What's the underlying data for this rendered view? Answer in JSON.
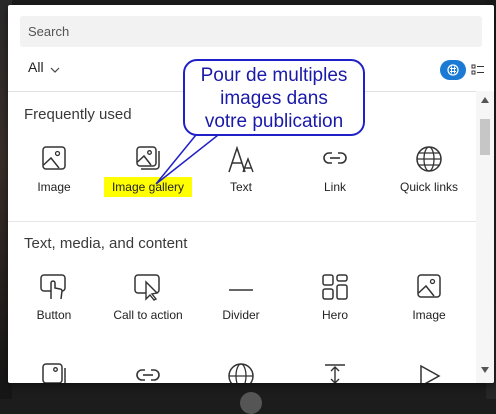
{
  "search": {
    "placeholder": "Search"
  },
  "filter": {
    "label": "All"
  },
  "sections": [
    {
      "title": "Frequently used",
      "items": [
        {
          "label": "Image",
          "icon": "image-icon"
        },
        {
          "label": "Image gallery",
          "icon": "image-gallery-icon"
        },
        {
          "label": "Text",
          "icon": "text-icon"
        },
        {
          "label": "Link",
          "icon": "link-icon"
        },
        {
          "label": "Quick links",
          "icon": "globe-icon"
        }
      ]
    },
    {
      "title": "Text, media, and content",
      "items": [
        {
          "label": "Button",
          "icon": "button-icon"
        },
        {
          "label": "Call to action",
          "icon": "call-to-action-icon"
        },
        {
          "label": "Divider",
          "icon": "divider-icon"
        },
        {
          "label": "Hero",
          "icon": "hero-icon"
        },
        {
          "label": "Image",
          "icon": "image-icon"
        }
      ]
    }
  ],
  "callout": {
    "lines": [
      "Pour de multiples",
      "images dans",
      "votre publication"
    ],
    "border_color": "#2020c8",
    "text_color": "#1a1aa8"
  },
  "highlight_color": "#ffff00",
  "accent_color": "#1a7ad4"
}
